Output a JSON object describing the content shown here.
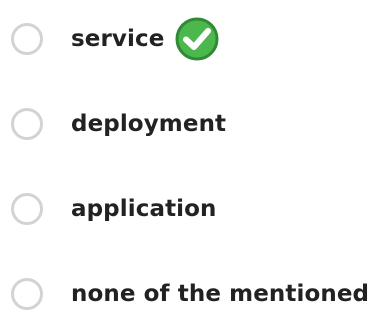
{
  "options": [
    {
      "label": "service",
      "selected": false,
      "correct": true
    },
    {
      "label": "deployment",
      "selected": false,
      "correct": false
    },
    {
      "label": "application",
      "selected": false,
      "correct": false
    },
    {
      "label": "none of the mentioned",
      "selected": false,
      "correct": false
    }
  ],
  "icons": {
    "correct_indicator": "check-circle-icon"
  },
  "colors": {
    "radio_border": "#d3d3d3",
    "check_fill": "#4cb74c",
    "check_stroke": "#2f8a35",
    "text": "#222222"
  }
}
